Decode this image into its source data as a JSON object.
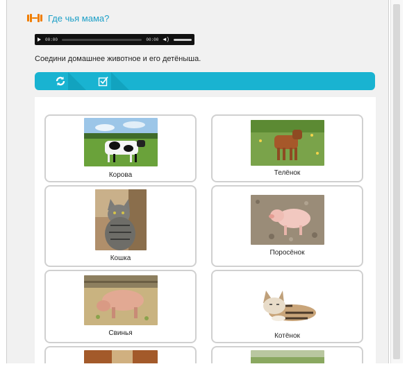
{
  "header": {
    "title": "Где чья мама?",
    "icon": "dumbbell-icon"
  },
  "audio": {
    "current_time": "00:00",
    "duration": "00:00"
  },
  "instruction": "Соедини домашнее животное и его детёныша.",
  "toolbar": {
    "buttons": [
      "reset-icon",
      "check-icon"
    ]
  },
  "cards": [
    {
      "label": "Корова",
      "image": "cow"
    },
    {
      "label": "Телёнок",
      "image": "calf"
    },
    {
      "label": "Кошка",
      "image": "cat"
    },
    {
      "label": "Поросёнок",
      "image": "piglet"
    },
    {
      "label": "Свинья",
      "image": "pig"
    },
    {
      "label": "Котёнок",
      "image": "kitten"
    }
  ],
  "colors": {
    "accent": "#19b3d1",
    "title": "#1b9fc7",
    "icon": "#f07d00"
  }
}
